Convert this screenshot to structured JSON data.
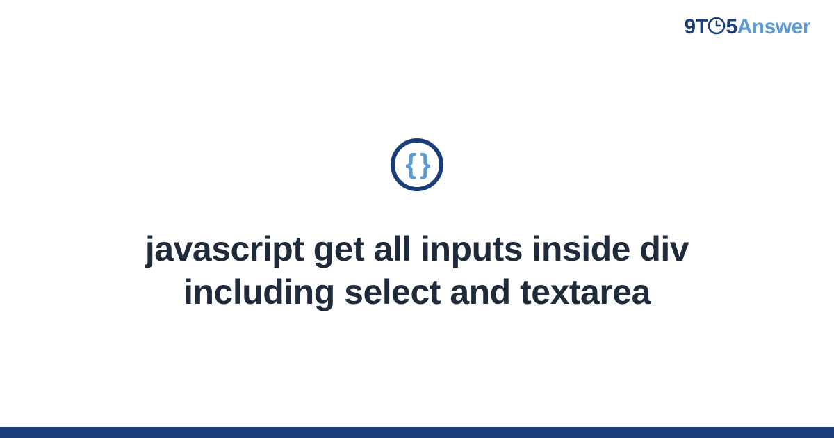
{
  "brand": {
    "part1": "9",
    "part2": "T",
    "part3": "5",
    "part4": "Answer"
  },
  "icon": {
    "symbol": "{ }"
  },
  "main": {
    "title": "javascript get all inputs inside div including select and textarea"
  },
  "colors": {
    "primary": "#1a3e7a",
    "accent": "#5b9bd5"
  }
}
